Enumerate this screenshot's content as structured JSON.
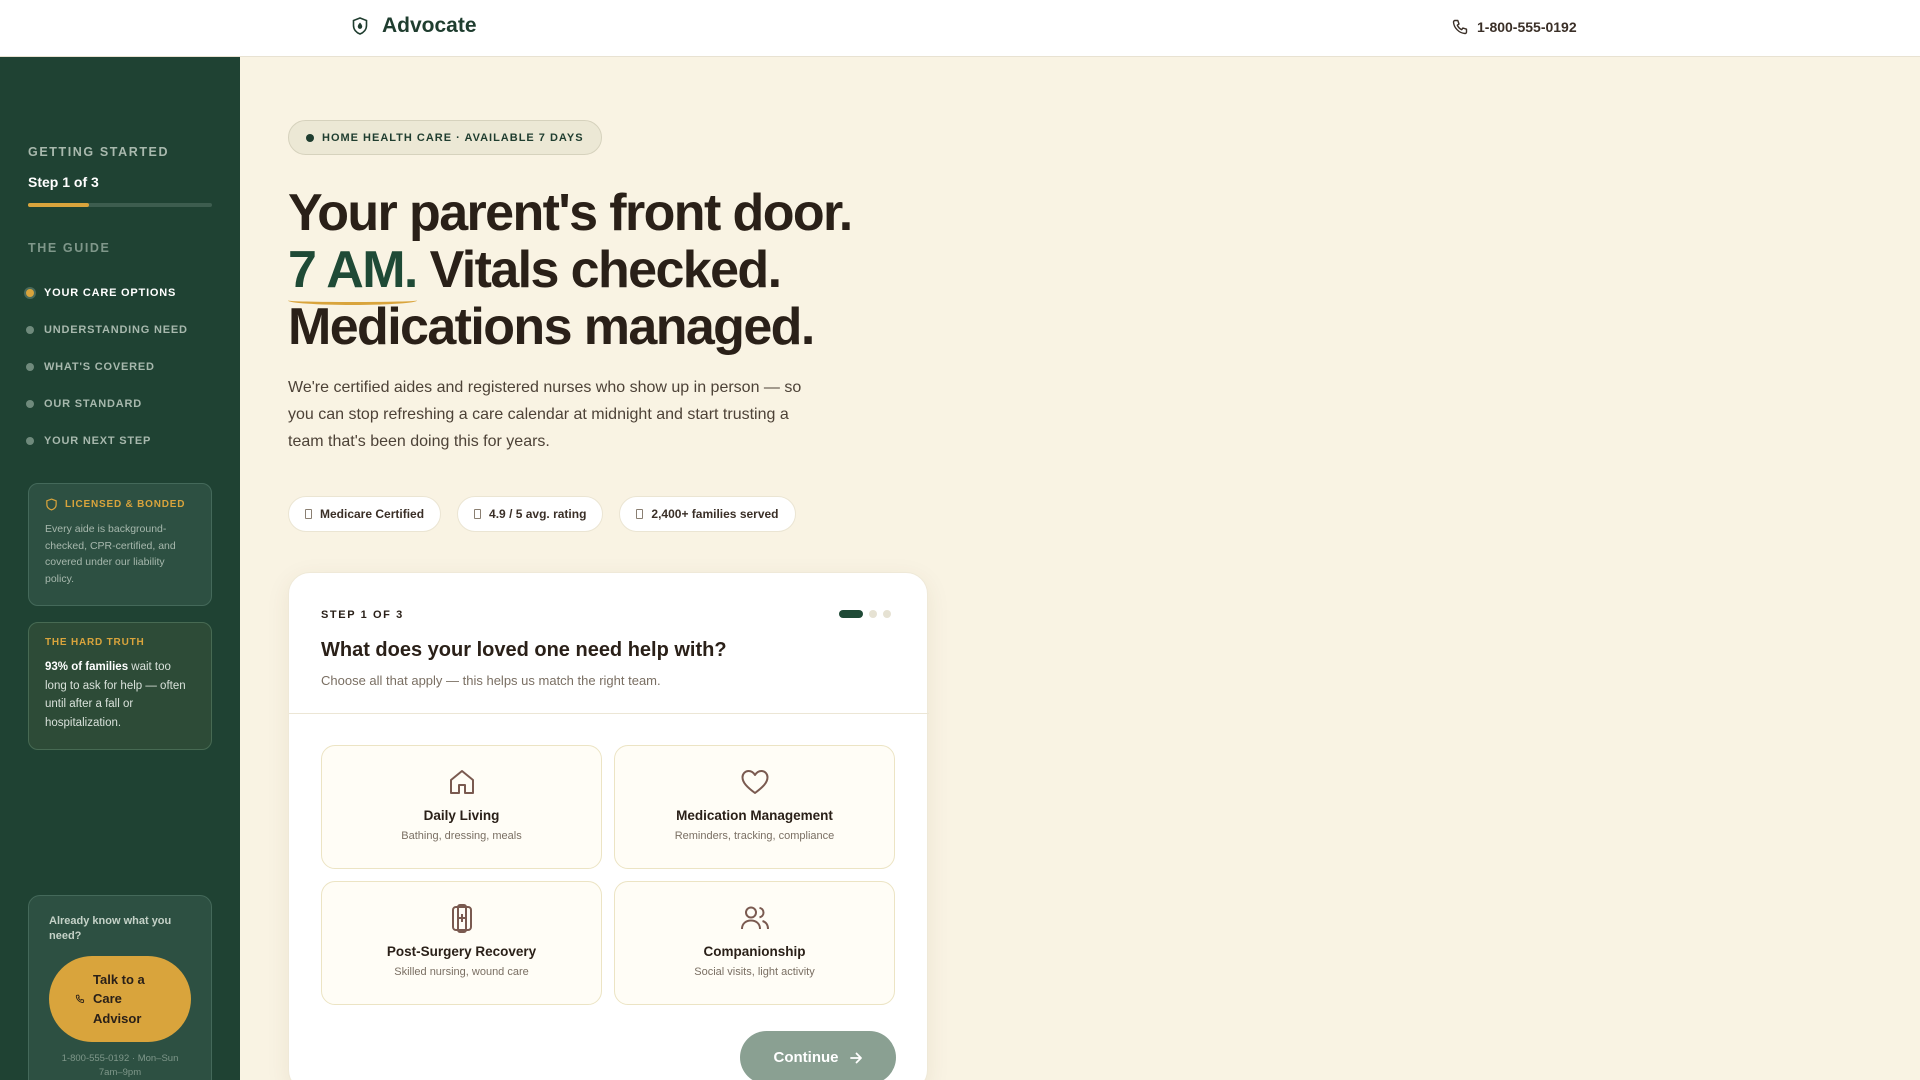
{
  "header": {
    "brand": "Advocate",
    "phone": "1-800-555-0192"
  },
  "sidebar": {
    "getting_started": "GETTING STARTED",
    "step": "Step 1 of 3",
    "progress_percent": 33,
    "guide_label": "THE GUIDE",
    "nav": [
      {
        "label": "YOUR CARE OPTIONS",
        "active": true
      },
      {
        "label": "UNDERSTANDING NEED",
        "active": false
      },
      {
        "label": "WHAT'S COVERED",
        "active": false
      },
      {
        "label": "OUR STANDARD",
        "active": false
      },
      {
        "label": "YOUR NEXT STEP",
        "active": false
      }
    ],
    "licensed": {
      "title": "LICENSED & BONDED",
      "body": "Every aide is background-checked, CPR-certified, and covered under our liability policy."
    },
    "hard_truth": {
      "title": "THE HARD TRUTH",
      "highlight": "93% of families",
      "body": " wait too long to ask for help — often until after a fall or hospitalization."
    },
    "advisor": {
      "question": "Already know what you need?",
      "button": "Talk to a Care Advisor",
      "footer": "1-800-555-0192 · Mon–Sun 7am–9pm"
    }
  },
  "main": {
    "badge": "HOME HEALTH CARE · AVAILABLE 7 DAYS",
    "headline_line1": "Your parent's front door.",
    "headline_accent": "7 AM.",
    "headline_line2_rest": " Vitals checked.",
    "headline_line3": "Medications managed.",
    "lede": "We're certified aides and registered nurses who show up in person — so you can stop refreshing a care calendar at midnight and start trusting a team that's been doing this for years.",
    "chips": [
      "Medicare Certified",
      "4.9 / 5 avg. rating",
      "2,400+ families served"
    ]
  },
  "step_card": {
    "step_label": "STEP 1 OF 3",
    "question": "What does your loved one need help with?",
    "subtitle": "Choose all that apply — this helps us match the right team.",
    "options": [
      {
        "title": "Daily Living",
        "subtitle": "Bathing, dressing, meals",
        "icon": "home-icon"
      },
      {
        "title": "Medication Management",
        "subtitle": "Reminders, tracking, compliance",
        "icon": "heart-icon"
      },
      {
        "title": "Post-Surgery Recovery",
        "subtitle": "Skilled nursing, wound care",
        "icon": "medical-kit-icon"
      },
      {
        "title": "Companionship",
        "subtitle": "Social visits, light activity",
        "icon": "users-icon"
      }
    ],
    "continue": "Continue"
  },
  "colors": {
    "sidebar_bg": "#1f4233",
    "accent_gold": "#d9a43c",
    "page_bg": "#f9f3e3",
    "brand_green": "#1f3d2f"
  }
}
